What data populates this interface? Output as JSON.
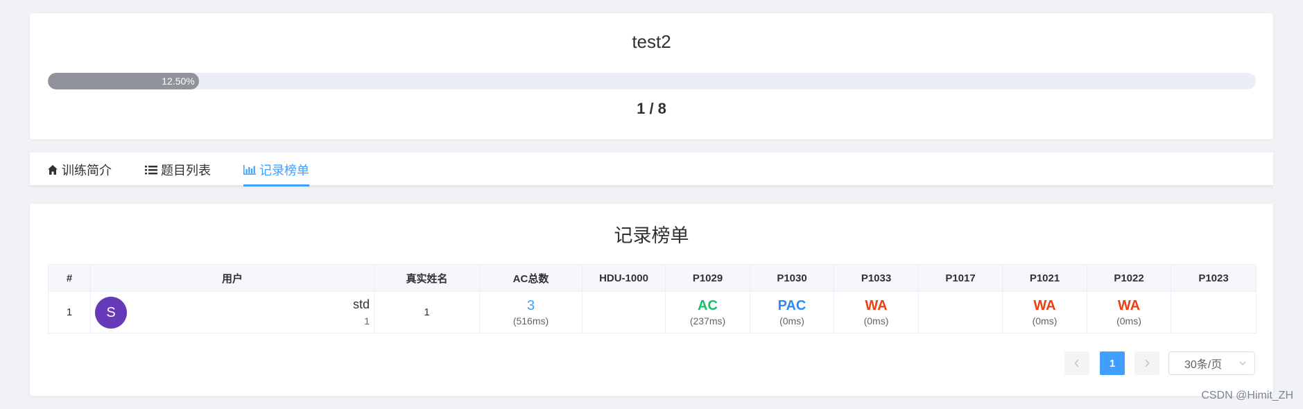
{
  "training": {
    "title": "test2",
    "progress_percent": 12.5,
    "progress_label": "12.50%",
    "progress_count": "1 / 8"
  },
  "tabs": [
    {
      "label": "训练简介",
      "icon": "home-icon"
    },
    {
      "label": "题目列表",
      "icon": "list-icon"
    },
    {
      "label": "记录榜单",
      "icon": "bar-chart-icon",
      "active": true
    }
  ],
  "rank": {
    "title": "记录榜单",
    "columns": [
      "#",
      "用户",
      "真实姓名",
      "AC总数",
      "HDU-1000",
      "P1029",
      "P1030",
      "P1033",
      "P1017",
      "P1021",
      "P1022",
      "P1023"
    ],
    "rows": [
      {
        "rank": "1",
        "avatar_letter": "S",
        "username": "std",
        "user_sub": "1",
        "realname": "1",
        "ac_total": "3",
        "ac_time": "(516ms)",
        "problems": [
          {
            "status": "",
            "time": ""
          },
          {
            "status": "AC",
            "time": "(237ms)"
          },
          {
            "status": "PAC",
            "time": "(0ms)"
          },
          {
            "status": "WA",
            "time": "(0ms)"
          },
          {
            "status": "",
            "time": ""
          },
          {
            "status": "WA",
            "time": "(0ms)"
          },
          {
            "status": "WA",
            "time": "(0ms)"
          },
          {
            "status": "",
            "time": ""
          }
        ]
      }
    ]
  },
  "pagination": {
    "current_page": "1",
    "page_size": "30条/页"
  },
  "colors": {
    "accent": "#409eff",
    "ac": "#19be6b",
    "pac": "#2d8cf0",
    "wa": "#ed3f14",
    "avatar": "#673ab7",
    "progress": "#909399"
  },
  "watermark": "CSDN @Himit_ZH"
}
